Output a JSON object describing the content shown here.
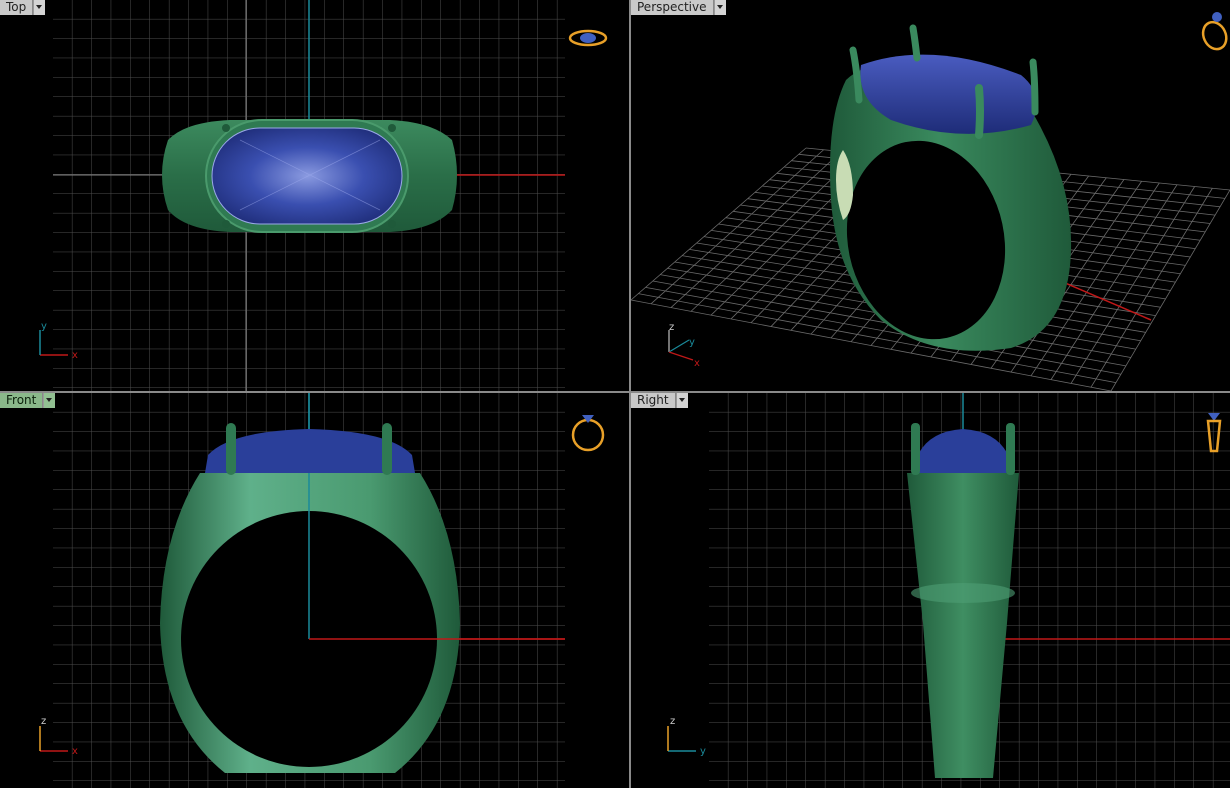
{
  "viewports": {
    "top": {
      "label": "Top",
      "axes": {
        "a": "y",
        "b": "x"
      }
    },
    "perspective": {
      "label": "Perspective",
      "axes": {
        "a": "z",
        "b": "y",
        "c": "x"
      }
    },
    "front": {
      "label": "Front",
      "axes": {
        "a": "z",
        "b": "x"
      }
    },
    "right": {
      "label": "Right",
      "axes": {
        "a": "z",
        "b": "y"
      }
    }
  },
  "active_viewport": "front",
  "colors": {
    "background": "#000000",
    "grid": "#5a5a5a",
    "grid_major": "#8a8a8a",
    "x_axis": "#c01818",
    "y_axis": "#1a8a9a",
    "ring_metal": "#2f7a52",
    "ring_metal_light": "#5fb08a",
    "gem": "#2a3f9a",
    "gem_light": "#6a7ad0",
    "lattice": "#c8dcb4",
    "tab_bg": "#c9c9c9",
    "tab_active_bg": "#8ab88a",
    "icon_gold": "#e8a028",
    "icon_blue": "#4060c0"
  },
  "icons": {
    "view_cube": "ring-view-icon"
  }
}
